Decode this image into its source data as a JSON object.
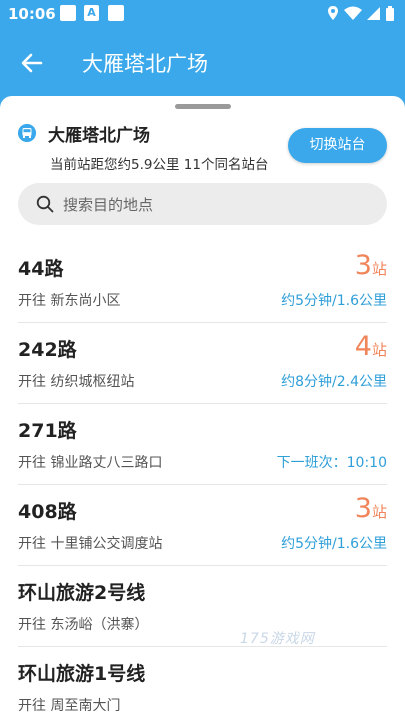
{
  "status_bar": {
    "time": "10:06",
    "badge": "A"
  },
  "app_bar": {
    "title": "大雁塔北广场"
  },
  "station": {
    "name": "大雁塔北广场",
    "info": "当前站距您约5.9公里   11个同名站台"
  },
  "switch_button": {
    "label": "切换站台"
  },
  "search": {
    "placeholder": "搜索目的地点"
  },
  "routes": [
    {
      "name": "44路",
      "dest": "开往  新东尚小区",
      "stops": "3",
      "stops_unit": "站",
      "eta": "约5分钟/1.6公里"
    },
    {
      "name": "242路",
      "dest": "开往  纺织城枢纽站",
      "stops": "4",
      "stops_unit": "站",
      "eta": "约8分钟/2.4公里"
    },
    {
      "name": "271路",
      "dest": "开往  锦业路丈八三路口",
      "stops": "",
      "stops_unit": "",
      "eta": "下一班次：10:10"
    },
    {
      "name": "408路",
      "dest": "开往  十里铺公交调度站",
      "stops": "3",
      "stops_unit": "站",
      "eta": "约5分钟/1.6公里"
    },
    {
      "name": "环山旅游2号线",
      "dest": "开往  东汤峪（洪寨）",
      "stops": "",
      "stops_unit": "",
      "eta": ""
    },
    {
      "name": "环山旅游1号线",
      "dest": "开往  周至南大门",
      "stops": "",
      "stops_unit": "",
      "eta": ""
    }
  ],
  "watermark": "175游戏网",
  "colors": {
    "primary": "#3aa8ea",
    "stops": "#f0855a",
    "eta": "#2f9fd8"
  }
}
